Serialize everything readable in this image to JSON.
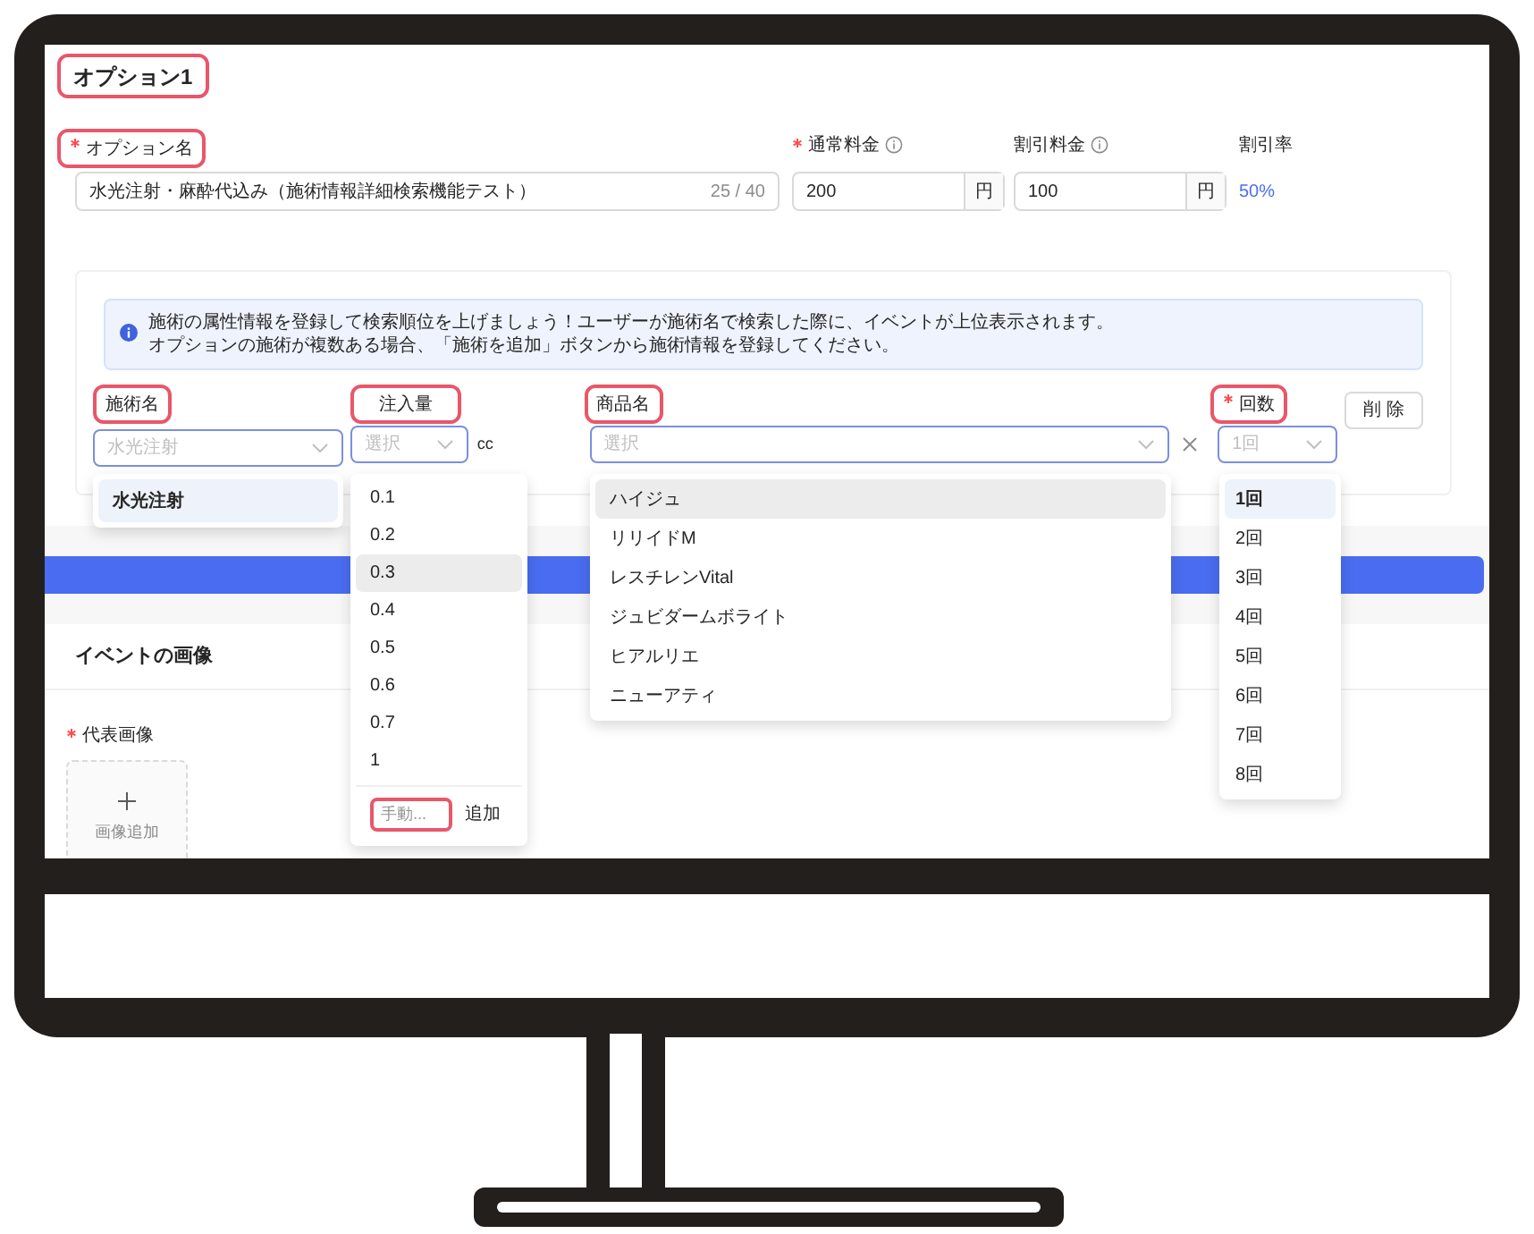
{
  "section_title": {
    "text": "オプション1",
    "highlighted": true
  },
  "option_name": {
    "label": "オプション名",
    "required": true,
    "highlighted": true,
    "value": "水光注射・麻酔代込み（施術情報詳細検索機能テスト）",
    "counter": "25 / 40"
  },
  "prices": [
    {
      "label": "通常料金",
      "required": true,
      "value": "200",
      "unit": "円"
    },
    {
      "label": "割引料金",
      "required": false,
      "value": "100",
      "unit": "円"
    }
  ],
  "discount_rate": {
    "label": "割引率",
    "value": "50%"
  },
  "info_alert": {
    "lines": [
      "施術の属性情報を登録して検索順位を上げましょう！ユーザーが施術名で検索した際に、イベントが上位表示されます。",
      "オプションの施術が複数ある場合、「施術を追加」ボタンから施術情報を登録してください。"
    ]
  },
  "treatment": {
    "label": "施術名",
    "highlighted": true,
    "placeholder": "水光注射",
    "options": [
      {
        "label": "水光注射",
        "selected": true
      }
    ]
  },
  "amount": {
    "label": "注入量",
    "highlighted": true,
    "placeholder": "選択",
    "unit": "cc",
    "options": [
      {
        "label": "0.1",
        "hovered": false
      },
      {
        "label": "0.2",
        "hovered": false
      },
      {
        "label": "0.3",
        "hovered": true
      },
      {
        "label": "0.4",
        "hovered": false
      },
      {
        "label": "0.5",
        "hovered": false
      },
      {
        "label": "0.6",
        "hovered": false
      },
      {
        "label": "0.7",
        "hovered": false
      },
      {
        "label": "1",
        "hovered": false
      }
    ],
    "manual": {
      "placeholder": "手動...",
      "highlighted": true
    },
    "add_label": "追加"
  },
  "product": {
    "label": "商品名",
    "highlighted": true,
    "placeholder": "選択",
    "options": [
      {
        "label": "ハイジュ",
        "hovered": true
      },
      {
        "label": "リリイドM",
        "hovered": false
      },
      {
        "label": "レスチレンVital",
        "hovered": false
      },
      {
        "label": "ジュビダームボライト",
        "hovered": false
      },
      {
        "label": "ヒアルリエ",
        "hovered": false
      },
      {
        "label": "ニューアティ",
        "hovered": false
      }
    ]
  },
  "count": {
    "label": "回数",
    "required": true,
    "highlighted": true,
    "placeholder": "1回",
    "options": [
      {
        "label": "1回",
        "selected": true
      },
      {
        "label": "2回",
        "selected": false
      },
      {
        "label": "3回",
        "selected": false
      },
      {
        "label": "4回",
        "selected": false
      },
      {
        "label": "5回",
        "selected": false
      },
      {
        "label": "6回",
        "selected": false
      },
      {
        "label": "7回",
        "selected": false
      },
      {
        "label": "8回",
        "selected": false
      }
    ]
  },
  "delete_button": "削 除",
  "images_section": {
    "title": "イベントの画像",
    "field_label": "代表画像",
    "required": true,
    "upload_label": "画像追加"
  }
}
